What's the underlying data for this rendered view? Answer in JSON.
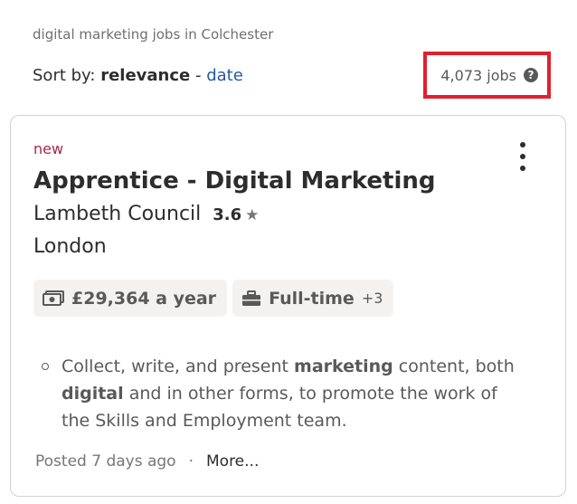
{
  "search_context": "digital marketing jobs in Colchester",
  "sort": {
    "prefix": "Sort by:",
    "current": "relevance",
    "separator": "-",
    "alternative": "date"
  },
  "job_count": "4,073 jobs",
  "job": {
    "badge": "new",
    "title": "Apprentice - Digital Marketing",
    "company": "Lambeth Council",
    "rating": "3.6",
    "location": "London",
    "salary": "£29,364 a year",
    "job_type": "Full-time",
    "job_type_more": "+3",
    "snippet": {
      "t1": "Collect, write, and present ",
      "b1": "marketing",
      "t2": " content, both ",
      "b2": "digital",
      "t3": " and in other forms, to promote the work of the Skills and Employment team."
    },
    "posted": "Posted 7 days ago",
    "footer_separator": "·",
    "more_link": "More..."
  },
  "icons": {
    "help": "help-circle-icon",
    "options": "more-vertical-icon",
    "star": "star-icon",
    "salary": "money-icon",
    "job_type": "briefcase-icon"
  },
  "colors": {
    "highlight_box": "#e0202e",
    "link": "#2557a7",
    "new_badge": "#a9274e"
  }
}
